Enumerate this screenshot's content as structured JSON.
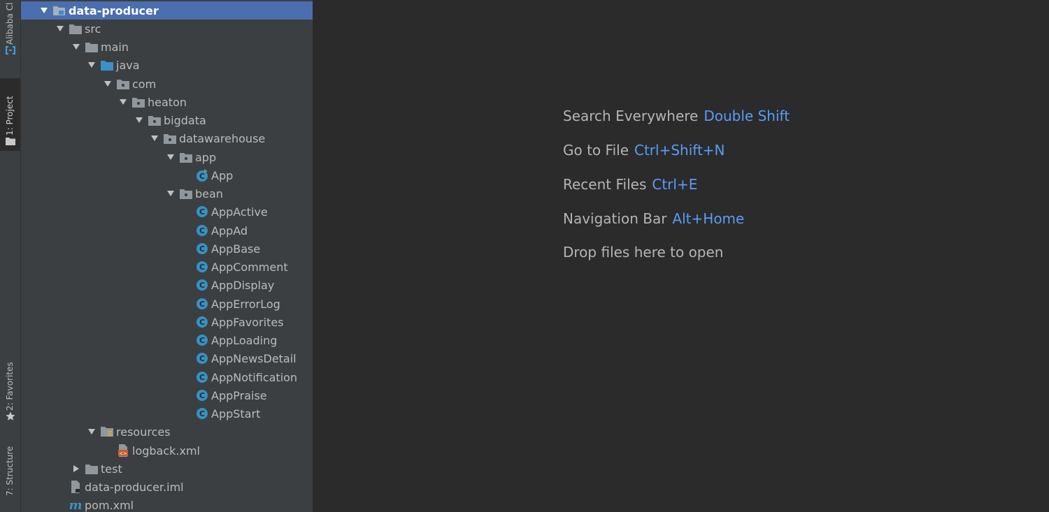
{
  "tool_strip": {
    "alibaba_label": "Alibaba Cl",
    "project_label": "1: Project",
    "favorites_label": "2: Favorites",
    "structure_label": "7: Structure"
  },
  "tree": {
    "root": "data-producer",
    "src": "src",
    "main": "main",
    "java": "java",
    "com": "com",
    "heaton": "heaton",
    "bigdata": "bigdata",
    "datawarehouse": "datawarehouse",
    "app_pkg": "app",
    "app_class": "App",
    "bean_pkg": "bean",
    "classes": [
      "AppActive",
      "AppAd",
      "AppBase",
      "AppComment",
      "AppDisplay",
      "AppErrorLog",
      "AppFavorites",
      "AppLoading",
      "AppNewsDetail",
      "AppNotification",
      "AppPraise",
      "AppStart"
    ],
    "resources": "resources",
    "logback": "logback.xml",
    "test": "test",
    "iml": "data-producer.iml",
    "pom": "pom.xml"
  },
  "editor_hints": {
    "search_label": "Search Everywhere",
    "search_key": "Double Shift",
    "gotofile_label": "Go to File",
    "gotofile_key": "Ctrl+Shift+N",
    "recent_label": "Recent Files",
    "recent_key": "Ctrl+E",
    "navbar_label": "Navigation Bar",
    "navbar_key": "Alt+Home",
    "drop_label": "Drop files here to open"
  },
  "colors": {
    "selection": "#4b6eaf",
    "shortcut": "#589df6",
    "class_icon": "#3592c4",
    "folder_icon": "#90989e",
    "source_folder_icon": "#3d8fc9",
    "xml_icon": "#c75f2f"
  }
}
